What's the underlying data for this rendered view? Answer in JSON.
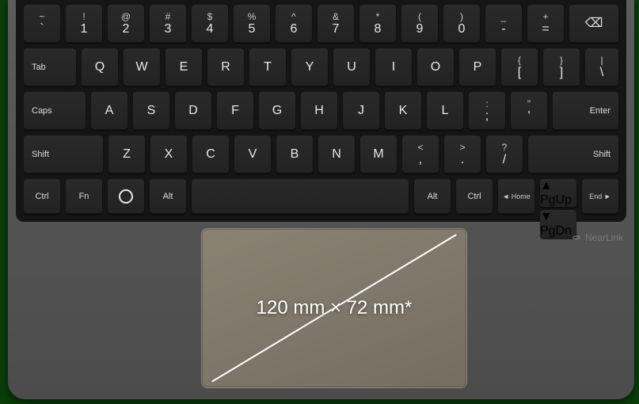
{
  "keyboard": {
    "row1": [
      {
        "upper": "~",
        "lower": "`"
      },
      {
        "upper": "!",
        "lower": "1"
      },
      {
        "upper": "@",
        "lower": "2"
      },
      {
        "upper": "#",
        "lower": "3"
      },
      {
        "upper": "$",
        "lower": "4"
      },
      {
        "upper": "%",
        "lower": "5"
      },
      {
        "upper": "^",
        "lower": "6"
      },
      {
        "upper": "&",
        "lower": "7"
      },
      {
        "upper": "*",
        "lower": "8"
      },
      {
        "upper": "(",
        "lower": "9"
      },
      {
        "upper": ")",
        "lower": "0"
      },
      {
        "upper": "_",
        "lower": "-"
      },
      {
        "upper": "+",
        "lower": "="
      }
    ],
    "backspace_icon": "⌫",
    "row2_mod": "Tab",
    "row2": [
      "Q",
      "W",
      "E",
      "R",
      "T",
      "Y",
      "U",
      "I",
      "O",
      "P"
    ],
    "row2_sym": [
      {
        "upper": "{",
        "lower": "["
      },
      {
        "upper": "}",
        "lower": "]"
      },
      {
        "upper": "|",
        "lower": "\\"
      }
    ],
    "row3_mod": "Caps",
    "row3": [
      "A",
      "S",
      "D",
      "F",
      "G",
      "H",
      "J",
      "K",
      "L"
    ],
    "row3_sym": [
      {
        "upper": ":",
        "lower": ";"
      },
      {
        "upper": "\"",
        "lower": "'"
      }
    ],
    "enter": "Enter",
    "row4_mod": "Shift",
    "row4": [
      "Z",
      "X",
      "C",
      "V",
      "B",
      "N",
      "M"
    ],
    "row4_sym": [
      {
        "upper": "<",
        "lower": ","
      },
      {
        "upper": ">",
        "lower": "."
      },
      {
        "upper": "?",
        "lower": "/"
      }
    ],
    "shift_r": "Shift",
    "row5": {
      "ctrl": "Ctrl",
      "fn": "Fn",
      "alt": "Alt",
      "altgr": "Alt",
      "ctrl_r": "Ctrl",
      "home": "◄ Home",
      "end": "End ►",
      "pgup": "▲ PgUp",
      "pgdn": "▼ PgDn"
    }
  },
  "touchpad": {
    "dimension_label": "120 mm × 72 mm*"
  },
  "brand": {
    "name": "NearLink"
  }
}
